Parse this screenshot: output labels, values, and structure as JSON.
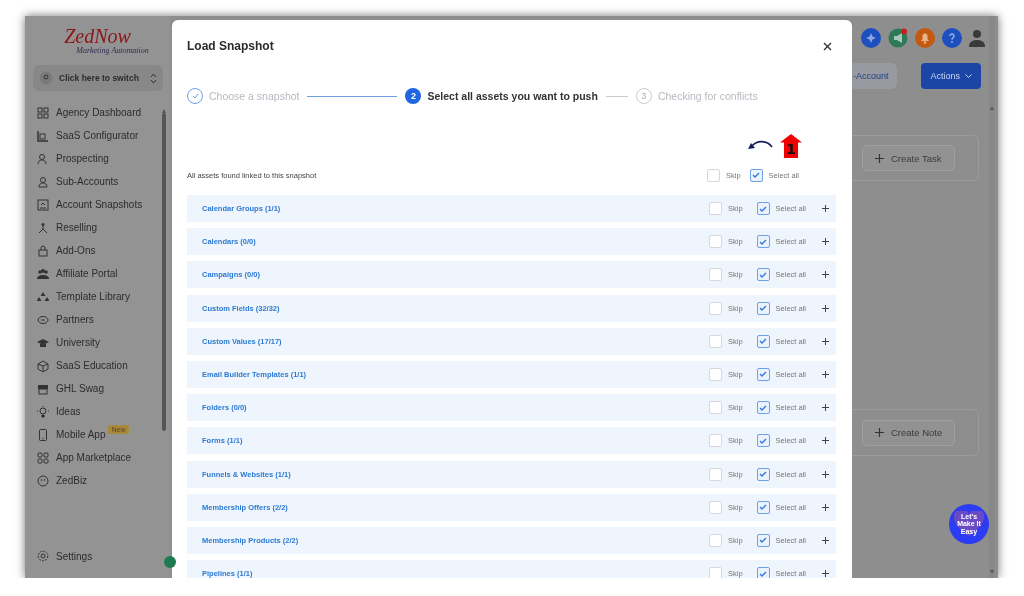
{
  "sidebar": {
    "logo": {
      "name": "ZedNow",
      "tagline": "Marketing Automation"
    },
    "switcher": {
      "label": "Click here to switch"
    },
    "items": [
      {
        "label": "Agency Dashboard"
      },
      {
        "label": "SaaS Configurator"
      },
      {
        "label": "Prospecting"
      },
      {
        "label": "Sub-Accounts"
      },
      {
        "label": "Account Snapshots"
      },
      {
        "label": "Reselling"
      },
      {
        "label": "Add-Ons"
      },
      {
        "label": "Affiliate Portal"
      },
      {
        "label": "Template Library"
      },
      {
        "label": "Partners"
      },
      {
        "label": "University"
      },
      {
        "label": "SaaS Education"
      },
      {
        "label": "GHL Swag"
      },
      {
        "label": "Ideas"
      },
      {
        "label": "Mobile App",
        "badge": "New"
      },
      {
        "label": "App Marketplace"
      },
      {
        "label": "ZedBiz"
      }
    ],
    "settings": {
      "label": "Settings"
    }
  },
  "modal": {
    "title": "Load Snapshot",
    "steps": [
      {
        "label": "Choose a snapshot",
        "completed": true,
        "current": false
      },
      {
        "number": "2",
        "label": "Select all assets you want to push",
        "completed": false,
        "current": true
      },
      {
        "number": "3",
        "label": "Checking for conflicts",
        "completed": false,
        "current": false
      }
    ],
    "intro": "All assets found linked to this snapshot",
    "header_options": [
      {
        "label": "Skip",
        "checked": false
      },
      {
        "label": "Select all",
        "checked": true
      }
    ],
    "annotation": {
      "marker": "1"
    },
    "assets": [
      {
        "name": "Calendar Groups (1/1)",
        "options": [
          {
            "label": "Skip",
            "checked": false
          },
          {
            "label": "Select all",
            "checked": true
          }
        ]
      },
      {
        "name": "Calendars (0/0)",
        "options": [
          {
            "label": "Skip",
            "checked": false
          },
          {
            "label": "Select all",
            "checked": true
          }
        ]
      },
      {
        "name": "Campaigns (0/0)",
        "options": [
          {
            "label": "Skip",
            "checked": false
          },
          {
            "label": "Select all",
            "checked": true
          }
        ]
      },
      {
        "name": "Custom Fields (32/32)",
        "options": [
          {
            "label": "Skip",
            "checked": false
          },
          {
            "label": "Select all",
            "checked": true
          }
        ]
      },
      {
        "name": "Custom Values (17/17)",
        "options": [
          {
            "label": "Skip",
            "checked": false
          },
          {
            "label": "Select all",
            "checked": true
          }
        ]
      },
      {
        "name": "Email Builder Templates (1/1)",
        "options": [
          {
            "label": "Skip",
            "checked": false
          },
          {
            "label": "Select all",
            "checked": true
          }
        ]
      },
      {
        "name": "Folders (0/0)",
        "options": [
          {
            "label": "Skip",
            "checked": false
          },
          {
            "label": "Select all",
            "checked": true
          }
        ]
      },
      {
        "name": "Forms (1/1)",
        "options": [
          {
            "label": "Skip",
            "checked": false
          },
          {
            "label": "Select all",
            "checked": true
          }
        ]
      },
      {
        "name": "Funnels & Websites (1/1)",
        "options": [
          {
            "label": "Skip",
            "checked": false
          },
          {
            "label": "Select all",
            "checked": true
          }
        ]
      },
      {
        "name": "Membership Offers (2/2)",
        "options": [
          {
            "label": "Skip",
            "checked": false
          },
          {
            "label": "Select all",
            "checked": true
          }
        ]
      },
      {
        "name": "Membership Products (2/2)",
        "options": [
          {
            "label": "Skip",
            "checked": false
          },
          {
            "label": "Select all",
            "checked": true
          }
        ]
      },
      {
        "name": "Pipelines (1/1)",
        "options": [
          {
            "label": "Skip",
            "checked": false
          },
          {
            "label": "Select all",
            "checked": true
          }
        ]
      }
    ]
  },
  "right_panel": {
    "buttons": [
      {
        "label": "-Account",
        "kind": "secondary"
      },
      {
        "label": "Actions",
        "kind": "primary"
      }
    ],
    "cards": [
      {
        "button": "Create Task"
      },
      {
        "button": "Create Note"
      }
    ],
    "help_badge": "Let's Make It Easy"
  }
}
